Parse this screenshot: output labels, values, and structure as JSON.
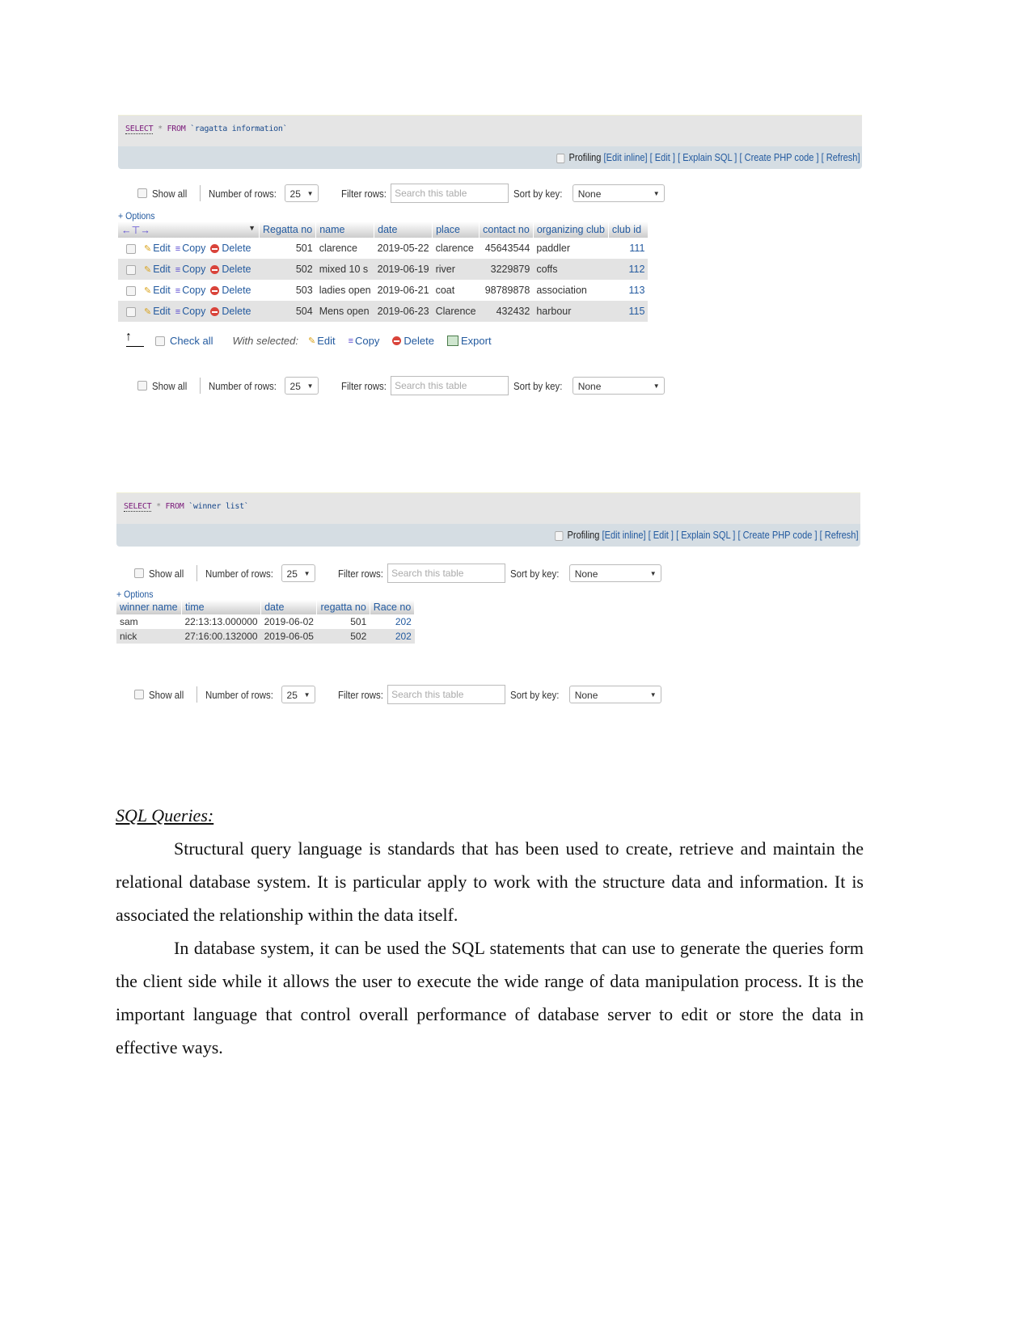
{
  "screenshot1": {
    "sql": {
      "keyword": "SELECT",
      "star": "*",
      "from": "FROM",
      "table": "`ragatta information`"
    },
    "toolbar": {
      "profiling": "Profiling",
      "edit_inline": "[Edit inline]",
      "edit": "[ Edit ]",
      "explain": "[ Explain SQL ]",
      "php": "[ Create PHP code ]",
      "refresh": "[ Refresh]"
    },
    "nav": {
      "show_all": "Show all",
      "rows_label": "Number of rows:",
      "rows_value": "25",
      "filter_label": "Filter rows:",
      "filter_placeholder": "Search this table",
      "sort_label": "Sort by key:",
      "sort_value": "None"
    },
    "options": "+ Options",
    "columns": [
      "Regatta no",
      "name",
      "date",
      "place",
      "contact no",
      "organizing club",
      "club id"
    ],
    "row_actions": {
      "edit": "Edit",
      "copy": "Copy",
      "delete": "Delete"
    },
    "rows": [
      {
        "regatta_no": "501",
        "name": "clarence",
        "date": "2019-05-22",
        "place": "clarence",
        "contact_no": "45643544",
        "club": "paddler",
        "club_id": "111"
      },
      {
        "regatta_no": "502",
        "name": "mixed 10 s",
        "date": "2019-06-19",
        "place": "river",
        "contact_no": "3229879",
        "club": "coffs",
        "club_id": "112"
      },
      {
        "regatta_no": "503",
        "name": "ladies open",
        "date": "2019-06-21",
        "place": "coat",
        "contact_no": "98789878",
        "club": "association",
        "club_id": "113"
      },
      {
        "regatta_no": "504",
        "name": "Mens open",
        "date": "2019-06-23",
        "place": "Clarence",
        "contact_no": "432432",
        "club": "harbour",
        "club_id": "115"
      }
    ],
    "bulk": {
      "check_all": "Check all",
      "with_selected": "With selected:",
      "edit": "Edit",
      "copy": "Copy",
      "delete": "Delete",
      "export": "Export"
    }
  },
  "screenshot2": {
    "sql": {
      "keyword": "SELECT",
      "star": "*",
      "from": "FROM",
      "table": "`winner list`"
    },
    "toolbar": {
      "profiling": "Profiling",
      "edit_inline": "[Edit inline]",
      "edit": "[ Edit ]",
      "explain": "[ Explain SQL ]",
      "php": "[ Create PHP code ]",
      "refresh": "[ Refresh]"
    },
    "nav": {
      "show_all": "Show all",
      "rows_label": "Number of rows:",
      "rows_value": "25",
      "filter_label": "Filter rows:",
      "filter_placeholder": "Search this table",
      "sort_label": "Sort by key:",
      "sort_value": "None"
    },
    "options": "+ Options",
    "columns": [
      "winner name",
      "time",
      "date",
      "regatta no",
      "Race no"
    ],
    "rows": [
      {
        "winner": "sam",
        "time": "22:13:13.000000",
        "date": "2019-06-02",
        "regatta_no": "501",
        "race_no": "202"
      },
      {
        "winner": "nick",
        "time": "27:16:00.132000",
        "date": "2019-06-05",
        "regatta_no": "502",
        "race_no": "202"
      }
    ]
  },
  "document": {
    "heading": "SQL Queries:",
    "paragraphs": [
      "Structural query language is standards that has been used to create, retrieve and maintain the relational database system. It is particular apply to work with the structure data and information. It is associated the relationship within the data itself.",
      "In database system, it can be used the SQL statements that can use to generate the queries form the client side while it allows the user to execute the wide range of data manipulation process. It is the important language that control overall performance of database server to edit or store the data in effective ways."
    ]
  }
}
